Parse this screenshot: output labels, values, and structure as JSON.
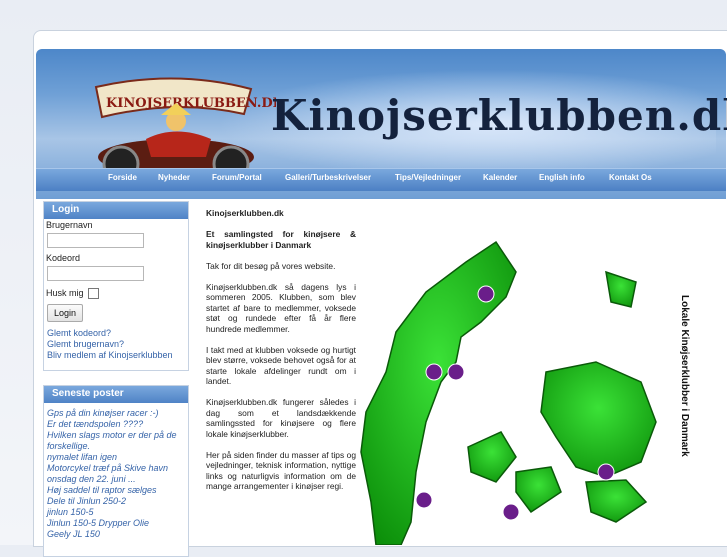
{
  "site": {
    "title": "Kinojserklubben.dk",
    "logo_text": "KINOJSERKLUBBEN.DK"
  },
  "nav": [
    "Forside",
    "Nyheder",
    "Forum/Portal",
    "Galleri/Turbeskrivelser",
    "Tips/Vejledninger",
    "Kalender",
    "English info",
    "Kontakt Os"
  ],
  "login": {
    "title": "Login",
    "username_label": "Brugernavn",
    "password_label": "Kodeord",
    "remember_label": "Husk mig",
    "button": "Login",
    "links": [
      "Glemt kodeord?",
      "Glemt brugernavn?",
      "Bliv medlem af Kinojserklubben"
    ]
  },
  "recent_posts": {
    "title": "Seneste poster",
    "items": [
      "Gps på din kinøjser racer :-)",
      "Er det tændspolen ????",
      "Hvilken slags motor er der på de",
      "forskellige.",
      "nymalet lifan igen",
      "Motorcykel træf på Skive havn",
      "onsdag den 22. juni ...",
      "Høj saddel til raptor sælges",
      "Dele til Jinlun 250-2",
      "jinlun 150-5",
      "Jinlun 150-5 Drypper Olie",
      "Geely JL 150"
    ]
  },
  "content": {
    "heading": "Kinojserklubben.dk",
    "subheading": "Et samlingsted for kinøjsere & kinøjserklubber i Danmark",
    "paragraphs": [
      "Tak for dit besøg på vores website.",
      "Kinøjserklubben.dk så dagens lys i sommeren 2005. Klubben, som blev startet af bare to medlemmer, voksede støt og rundede efter få år flere hundrede medlemmer.",
      "I takt med at klubben voksede og hurtigt blev større, voksede behovet også for at starte lokale afdelinger rundt om i landet.",
      "Kinøjserklubben.dk fungerer således i dag som et landsdækkende samlingssted for kinøjsere og flere lokale kinøjserklubber.",
      "Her på siden finder du masser af tips og vejledninger, teknisk information, nyttige links og naturligvis information om de mange arrangementer i kinøjser regi."
    ]
  },
  "map_label": "Lokale Kinøjserklubber i Danmark",
  "colors": {
    "nav": "#4c80c4",
    "link": "#3563a8",
    "map_green": "#22c21c"
  }
}
